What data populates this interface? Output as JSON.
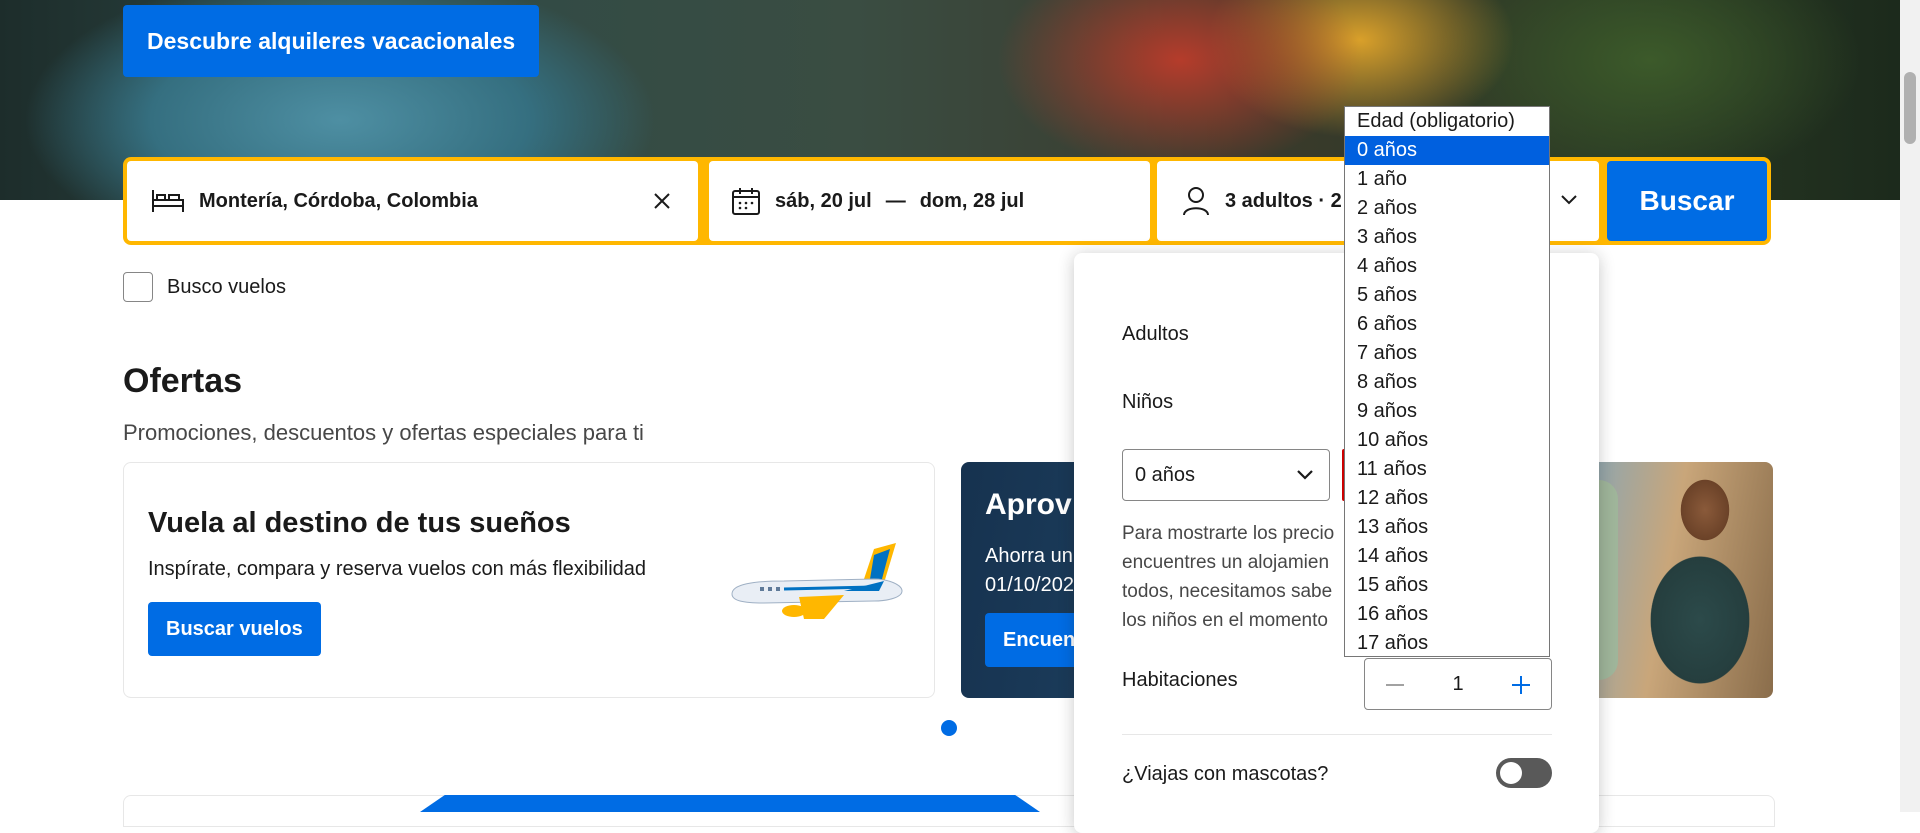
{
  "hero": {
    "cta_label": "Descubre alquileres vacacionales"
  },
  "search": {
    "destination": "Montería, Córdoba, Colombia",
    "checkin": "sáb, 20 jul",
    "date_separator": "—",
    "checkout": "dom, 28 jul",
    "occupancy": "3 adultos · 2",
    "search_button": "Buscar",
    "flights_checkbox_label": "Busco vuelos"
  },
  "offers": {
    "title": "Ofertas",
    "subtitle": "Promociones, descuentos y ofertas especiales para ti",
    "card1": {
      "title": "Vuela al destino de tus sueños",
      "description": "Inspírate, compara y reserva vuelos con más flexibilidad",
      "button": "Buscar vuelos"
    },
    "card2": {
      "title": "Aprov",
      "line1": "Ahorra un",
      "line2": "01/10/202",
      "button": "Encuent"
    }
  },
  "occupancy_popup": {
    "adults_label": "Adultos",
    "children_label": "Niños",
    "child_age_value": "0 años",
    "info_text_lines": [
      "Para mostrarte los precio",
      "encuentres un alojamien",
      "todos, necesitamos sabe",
      "los niños en el momento"
    ],
    "rooms_label": "Habitaciones",
    "rooms_value": "1",
    "pets_label": "¿Viajas con mascotas?"
  },
  "age_dropdown": {
    "options": [
      "Edad (obligatorio)",
      "0 años",
      "1 año",
      "2 años",
      "3 años",
      "4 años",
      "5 años",
      "6 años",
      "7 años",
      "8 años",
      "9 años",
      "10 años",
      "11 años",
      "12 años",
      "13 años",
      "14 años",
      "15 años",
      "16 años",
      "17 años"
    ],
    "selected_index": 1
  },
  "colors": {
    "brand_blue": "#006ce4",
    "search_border": "#ffb700",
    "dropdown_highlight": "#0060df"
  },
  "icons": {
    "destination": "bed-icon",
    "dates": "calendar-icon",
    "occupancy": "person-icon",
    "clear": "close-icon",
    "chevron": "chevron-down-icon",
    "minus": "minus-icon",
    "plus": "plus-icon"
  }
}
